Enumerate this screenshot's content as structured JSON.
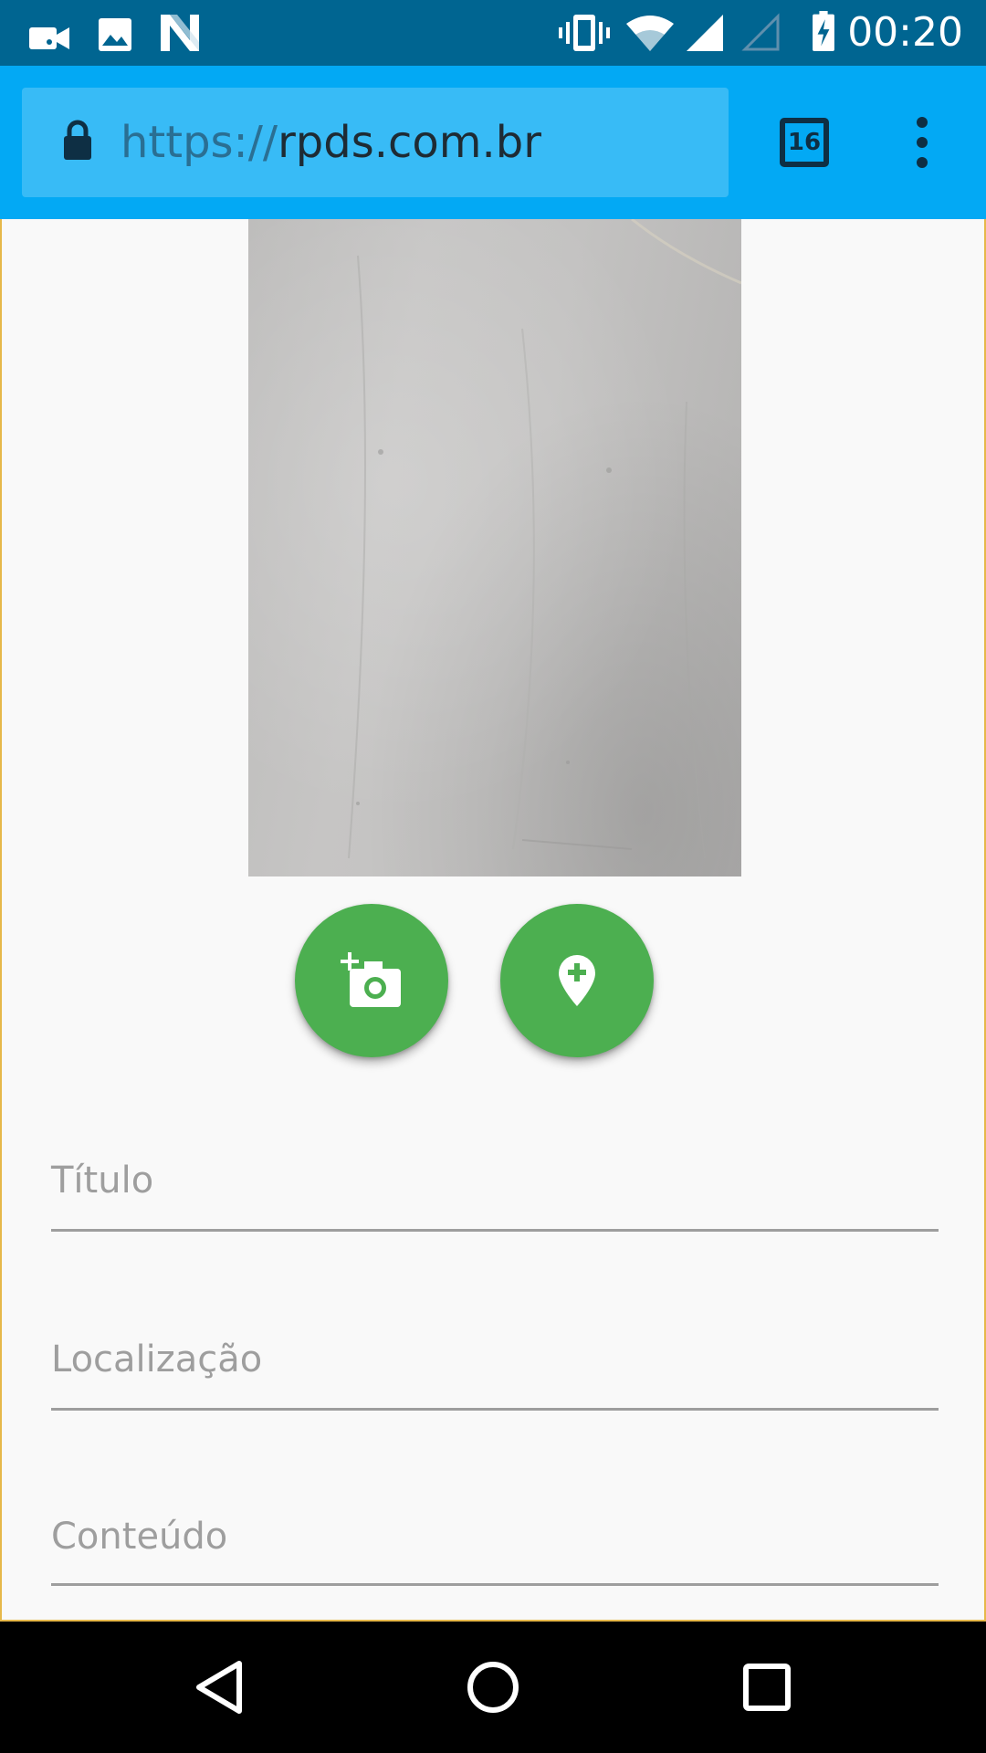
{
  "status_bar": {
    "time": "00:20",
    "left_icons": [
      "video-call-icon",
      "image-icon",
      "n-logo-icon"
    ],
    "right_icons": [
      "vibrate-icon",
      "wifi-icon",
      "signal-icon",
      "signal-empty-icon",
      "battery-charging-icon"
    ]
  },
  "browser": {
    "url_scheme": "https://",
    "url_host": "rpds.com.br",
    "tab_count": "16",
    "toolbar_color": "#03a9f4"
  },
  "form": {
    "buttons": [
      {
        "name": "add-photo",
        "icon": "add-a-photo-icon"
      },
      {
        "name": "add-location",
        "icon": "add-location-icon"
      }
    ],
    "fields": [
      {
        "label": "Título",
        "value": ""
      },
      {
        "label": "Localização",
        "value": ""
      },
      {
        "label": "Conteúdo",
        "value": ""
      }
    ],
    "accent_color": "#4caf50"
  },
  "nav_bar": {
    "buttons": [
      "back-icon",
      "home-icon",
      "recents-icon"
    ]
  }
}
